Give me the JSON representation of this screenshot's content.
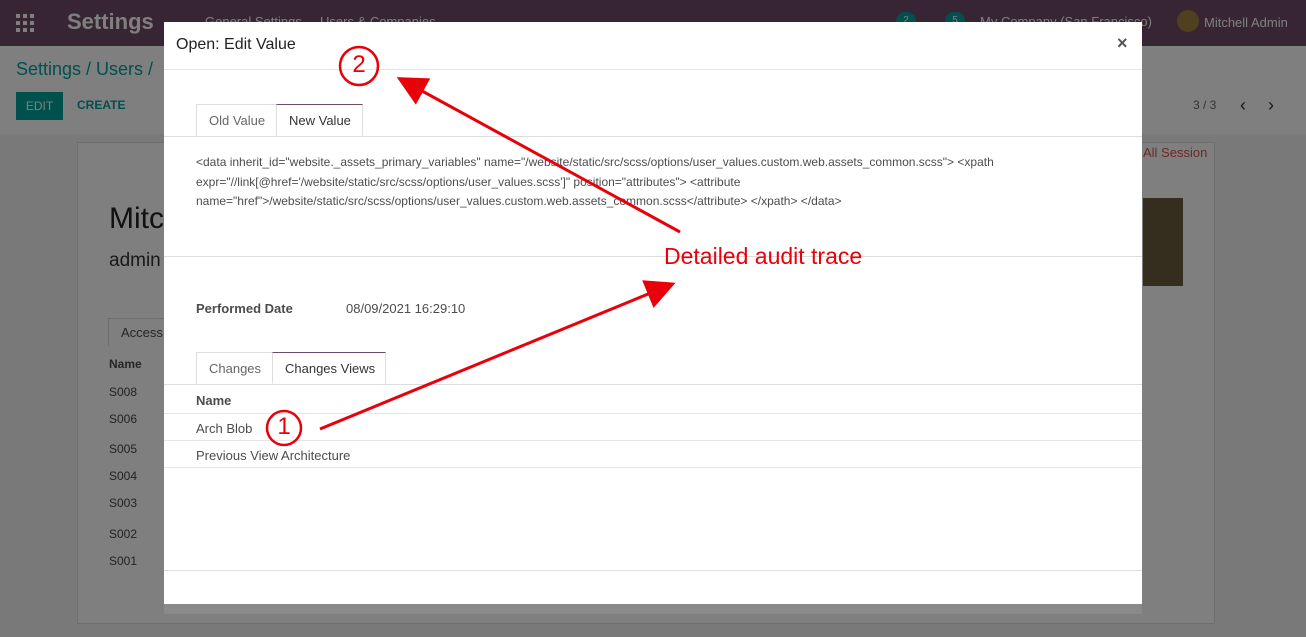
{
  "topbar": {
    "app_title": "Settings",
    "menu": [
      "General Settings",
      "Users & Companies"
    ],
    "chat_badge": "2",
    "activity_badge": "5",
    "company": "My Company (San Francisco)",
    "user": "Mitchell Admin"
  },
  "control_panel": {
    "breadcrumb": "Settings / Users /",
    "edit_label": "EDIT",
    "create_label": "CREATE",
    "pager": "3 / 3"
  },
  "background_form": {
    "name_partial": "Mitc",
    "login_partial": "admin",
    "kill_sessions": "All Session",
    "access_tab_partial": "Access",
    "list_header": "Name",
    "rows": [
      "S008",
      "S006",
      "S005",
      "S004",
      "S003",
      "S002",
      "S001"
    ]
  },
  "audit_dialog": {
    "performed_date_label": "Performed Date",
    "performed_date_value": "08/09/2021 16:29:10",
    "tabs": [
      "Changes",
      "Changes Views"
    ],
    "list_header": "Name",
    "rows": [
      "Arch Blob",
      "Previous View Architecture"
    ]
  },
  "value_dialog": {
    "title": "Open: Edit Value",
    "close": "×",
    "tabs": [
      "Old Value",
      "New Value"
    ],
    "content": "<data inherit_id=\"website._assets_primary_variables\" name=\"/website/static/src/scss/options/user_values.custom.web.assets_common.scss\"> <xpath expr=\"//link[@href='/website/static/src/scss/options/user_values.scss']\" position=\"attributes\"> <attribute name=\"href\">/website/static/src/scss/options/user_values.custom.web.assets_common.scss</attribute> </xpath> </data>"
  },
  "annotations": {
    "label": "Detailed audit trace",
    "marker_1": "1",
    "marker_2": "2",
    "color": "#e8000b"
  }
}
